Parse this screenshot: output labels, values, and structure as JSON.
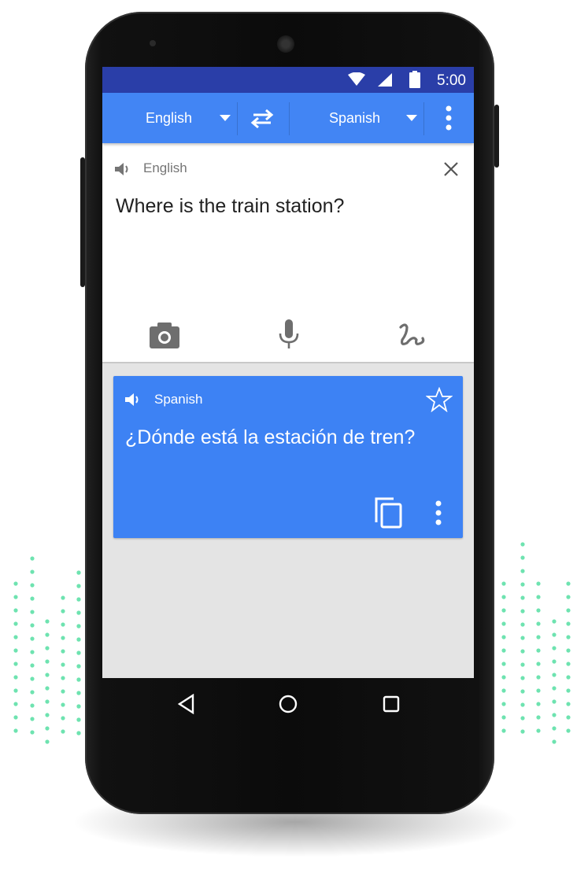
{
  "status_bar": {
    "time": "5:00",
    "icons": [
      "wifi-icon",
      "signal-icon",
      "battery-icon"
    ]
  },
  "toolbar": {
    "source_language": "English",
    "target_language": "Spanish",
    "swap_icon": "swap-arrows-icon",
    "menu_icon": "more-vert-icon"
  },
  "input": {
    "language_label": "English",
    "text": "Where is the train station?",
    "tools": [
      "camera-icon",
      "microphone-icon",
      "handwriting-icon"
    ]
  },
  "output": {
    "language_label": "Spanish",
    "text": "¿Dónde está la estación de tren?",
    "actions": [
      "star-icon",
      "copy-icon",
      "more-vert-icon"
    ]
  },
  "nav_bar": [
    "back-icon",
    "home-icon",
    "recents-icon"
  ],
  "colors": {
    "accent": "#4285f4",
    "status_bar": "#2a3ea8",
    "dots": "#6ee3b0",
    "card": "#3d82f4"
  }
}
